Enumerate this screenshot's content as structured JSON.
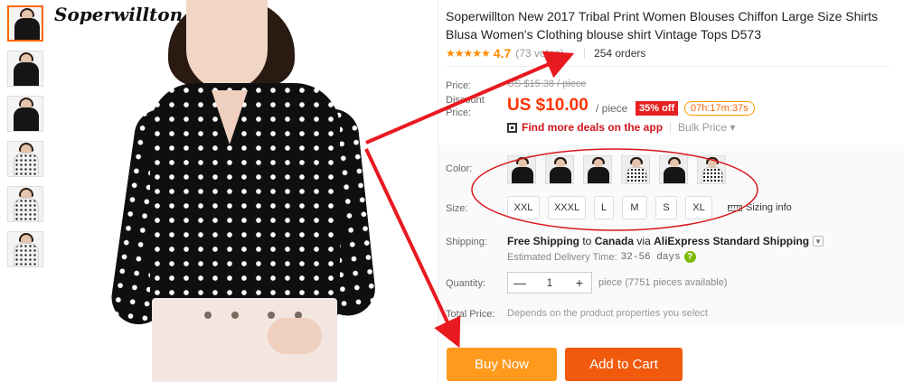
{
  "gallery": {
    "brand": "Soperwillton",
    "thumbnails": [
      "thumb-1",
      "thumb-2",
      "thumb-3",
      "thumb-4",
      "thumb-5",
      "thumb-6"
    ]
  },
  "product": {
    "title": "Soperwillton New 2017 Tribal Print Women Blouses Chiffon Large Size Shirts Blusa Women's Clothing blouse shirt Vintage Tops D573",
    "rating": {
      "stars": "★★★★★",
      "value": "4.7",
      "votes": "(73 votes)",
      "orders": "254 orders"
    }
  },
  "price": {
    "label": "Price:",
    "original": "US $15.38 / piece",
    "discount_label": "Discount Price:",
    "discount": "US $10.00",
    "per": "/ piece",
    "off": "35% off",
    "timer": "07h:17m:37s",
    "deals_link": "Find more deals on the app",
    "bulk": "Bulk Price"
  },
  "options": {
    "color_label": "Color:",
    "colors": [
      "color-1",
      "color-2",
      "color-3",
      "color-4",
      "color-5",
      "color-6"
    ],
    "size_label": "Size:",
    "sizes": [
      "XXL",
      "XXXL",
      "L",
      "M",
      "S",
      "XL"
    ],
    "sizing_info": "Sizing info"
  },
  "shipping": {
    "label": "Shipping:",
    "free": "Free Shipping",
    "to_text": " to ",
    "country": "Canada",
    "via_text": " via ",
    "method": "AliExpress Standard Shipping",
    "estimated_label": "Estimated Delivery Time:",
    "estimated_days": "32-56 days"
  },
  "quantity": {
    "label": "Quantity:",
    "value": "1",
    "minus": "—",
    "plus": "+",
    "available": "piece (7751 pieces available)"
  },
  "total": {
    "label": "Total Price:",
    "text": "Depends on the product properties you select"
  },
  "actions": {
    "buy_now": "Buy Now",
    "add_to_cart": "Add to Cart"
  },
  "colors": {
    "accent_orange": "#ff9a1d",
    "cart_orange": "#f15a0c",
    "price_red": "#ff3300",
    "annotation_red": "#e8191f"
  }
}
